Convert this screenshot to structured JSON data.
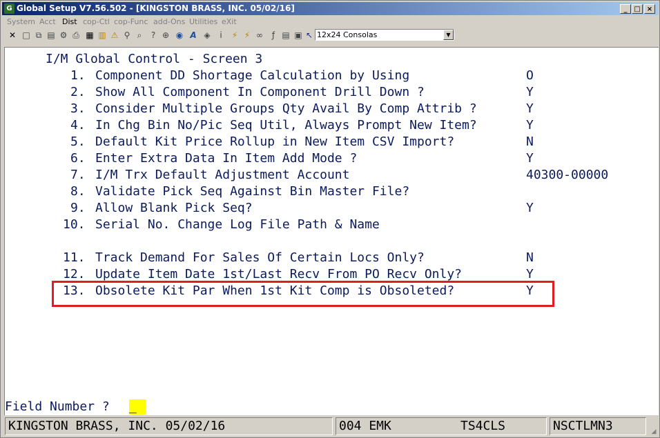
{
  "window": {
    "title": "Global Setup V7.56.502 - [KINGSTON BRASS, INC. 05/02/16]",
    "controls": [
      "_",
      "□",
      "×"
    ]
  },
  "menu": [
    "System",
    "Acct",
    "Dist",
    "cop-Ctl",
    "cop-Func",
    "add-Ons",
    "Utilities",
    "eXit"
  ],
  "font_select": {
    "value": "12x24 Consolas"
  },
  "screen": {
    "heading": "I/M Global Control - Screen 3",
    "items": [
      {
        "num": "1.",
        "label": "Component DD Shortage Calculation by Using",
        "value": "O"
      },
      {
        "num": "2.",
        "label": "Show All Component In Component Drill Down ?",
        "value": "Y"
      },
      {
        "num": "3.",
        "label": "Consider Multiple Groups Qty Avail By Comp Attrib ?",
        "value": "Y"
      },
      {
        "num": "4.",
        "label": "In Chg Bin No/Pic Seq Util, Always Prompt New Item?",
        "value": "Y"
      },
      {
        "num": "5.",
        "label": "Default Kit Price Rollup in New Item CSV Import?",
        "value": "N"
      },
      {
        "num": "6.",
        "label": "Enter Extra Data In Item Add Mode ?",
        "value": "Y"
      },
      {
        "num": "7.",
        "label": "I/M Trx Default Adjustment Account",
        "value": "40300-00000"
      },
      {
        "num": "8.",
        "label": "Validate Pick Seq Against Bin Master File?",
        "value": ""
      },
      {
        "num": "9.",
        "label": "Allow Blank Pick Seq?",
        "value": "Y"
      },
      {
        "num": "10.",
        "label": "Serial No. Change Log File Path & Name",
        "value": ""
      },
      {
        "num": "11.",
        "label": "Track Demand For Sales Of Certain Locs Only?",
        "value": "N"
      },
      {
        "num": "12.",
        "label": "Update Item Date 1st/Last Recv From PO Recv Only?",
        "value": "Y"
      },
      {
        "num": "13.",
        "label": "Obsolete Kit Par When 1st Kit Comp is Obsoleted?",
        "value": "Y"
      }
    ]
  },
  "prompt": {
    "label": "Field Number ?",
    "value": "_"
  },
  "status": {
    "company": "KINGSTON BRASS, INC. 05/02/16",
    "user": "004 EMK",
    "terminal": "TS4CLS",
    "program": "NSCTLMN3"
  },
  "colors": {
    "highlight_box": "#e41b23",
    "screen_text": "#0a1a5c",
    "cursor": "#ffff00"
  }
}
